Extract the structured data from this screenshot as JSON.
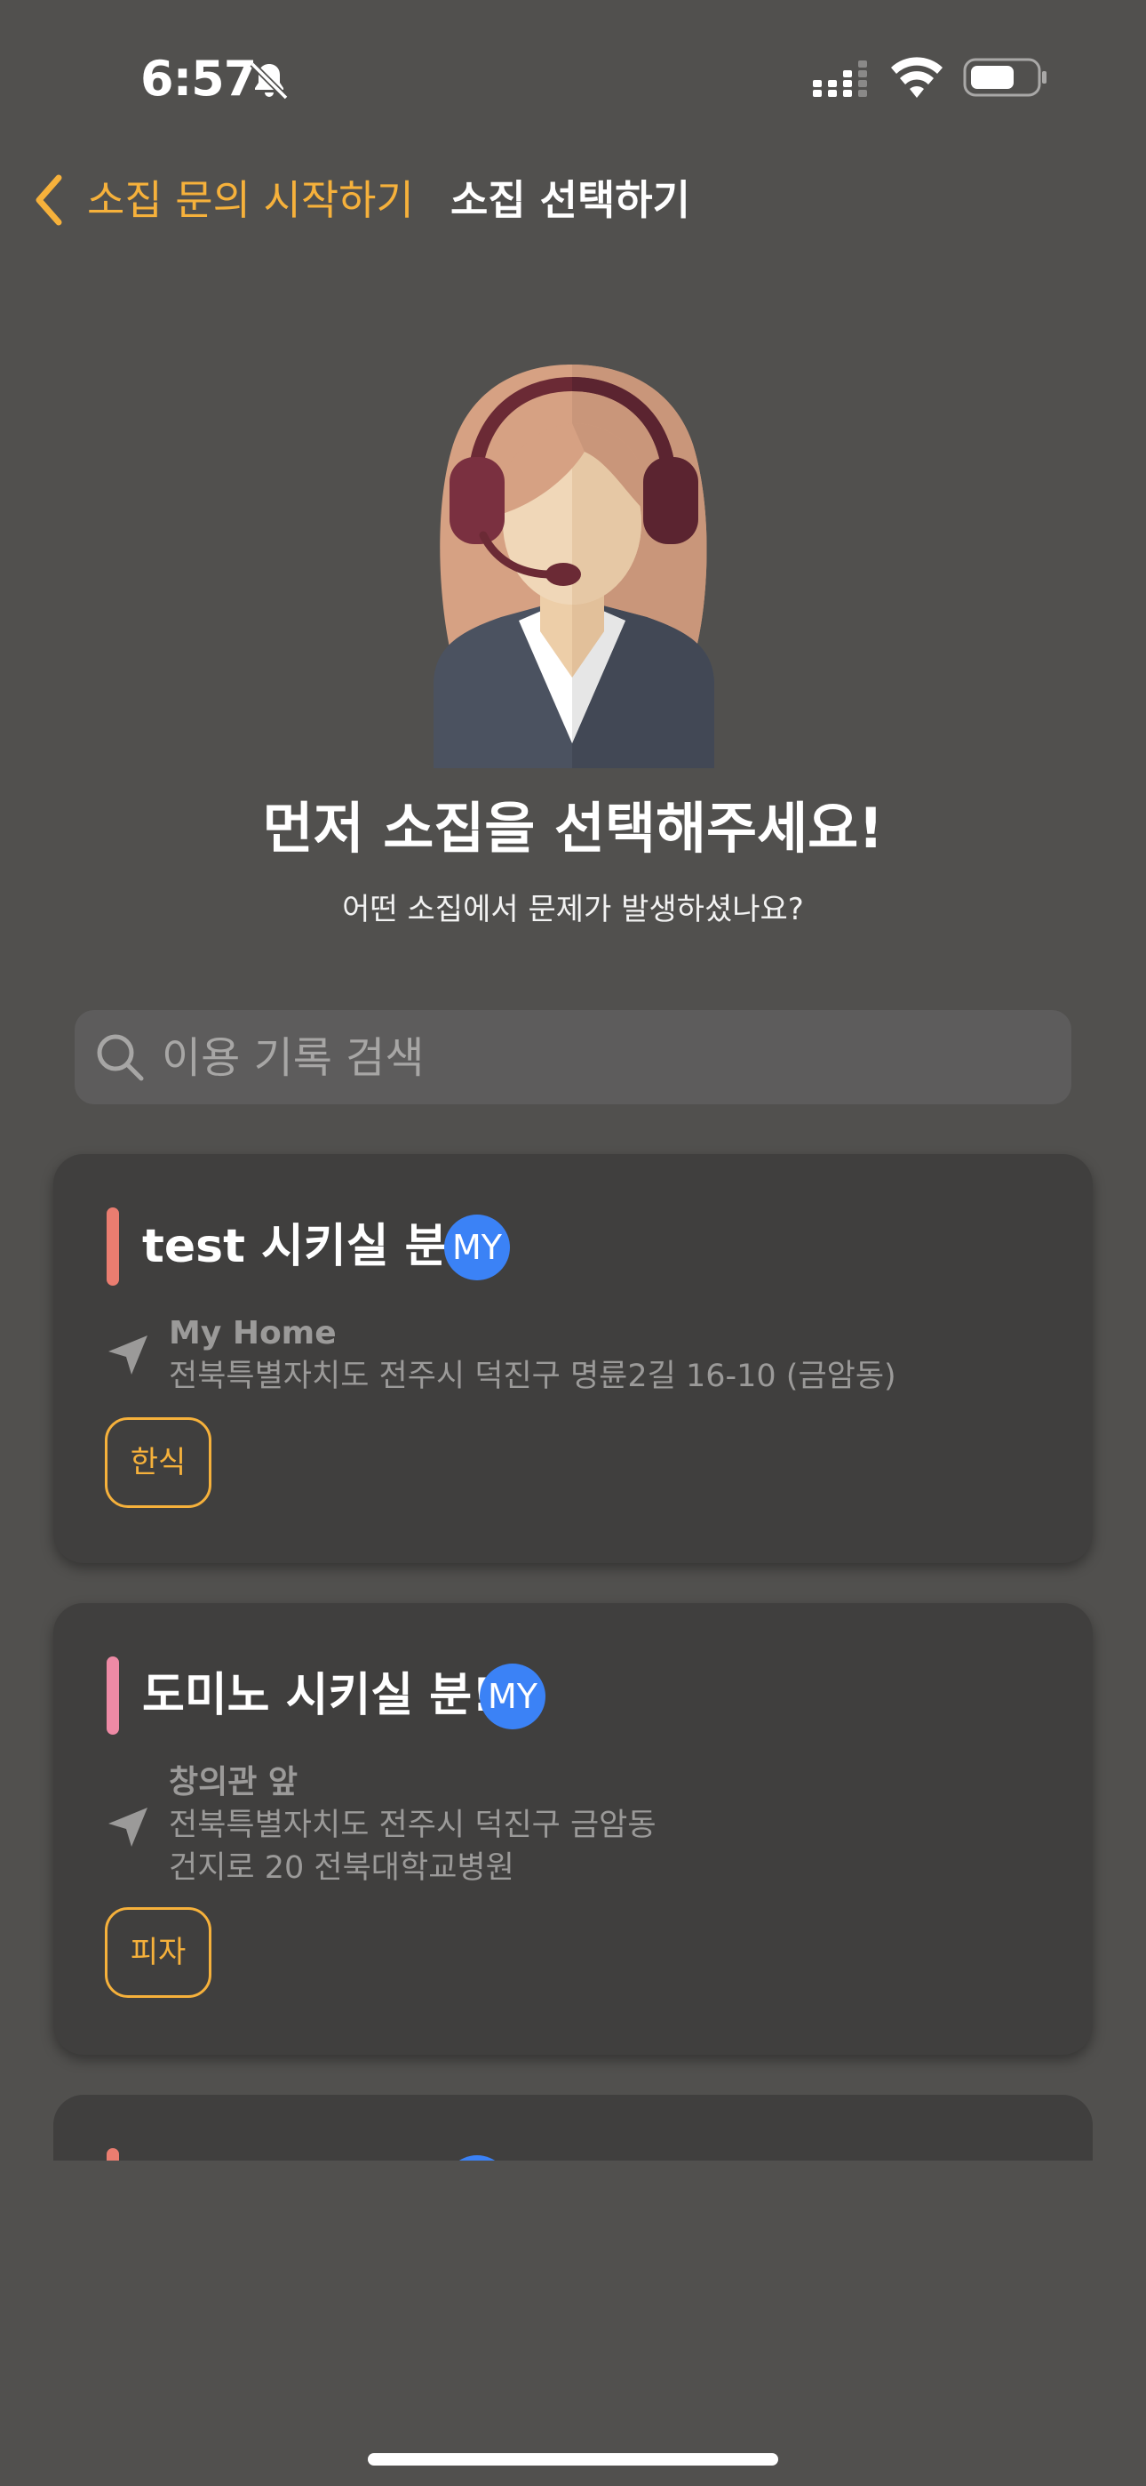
{
  "status_bar": {
    "time": "6:57"
  },
  "nav": {
    "back_label": "소집 문의 시작하기",
    "title": "소집 선택하기"
  },
  "header": {
    "headline": "먼저 소집을 선택해주세요!",
    "subheadline": "어떤 소집에서 문제가 발생하셨나요?"
  },
  "search": {
    "placeholder": "이용 기록 검색"
  },
  "cards": [
    {
      "title": "test 시키실 분!",
      "badge": "MY",
      "place_name": "My Home",
      "address_lines": [
        "전북특별자치도 전주시 덕진구 명륜2길 16-10 (금암동)"
      ],
      "tag": "한식",
      "accent_color": "#ea7d70"
    },
    {
      "title": "도미노 시키실 분!",
      "badge": "MY",
      "place_name": "창의관 앞",
      "address_lines": [
        "전북특별자치도 전주시 덕진구 금암동",
        "건지로 20 전북대학교병원"
      ],
      "tag": "피자",
      "accent_color": "#ee8aa5"
    }
  ],
  "colors": {
    "background": "#51504e",
    "accent": "#f6b13b",
    "card": "#403f3e",
    "badge": "#3b82f6"
  }
}
